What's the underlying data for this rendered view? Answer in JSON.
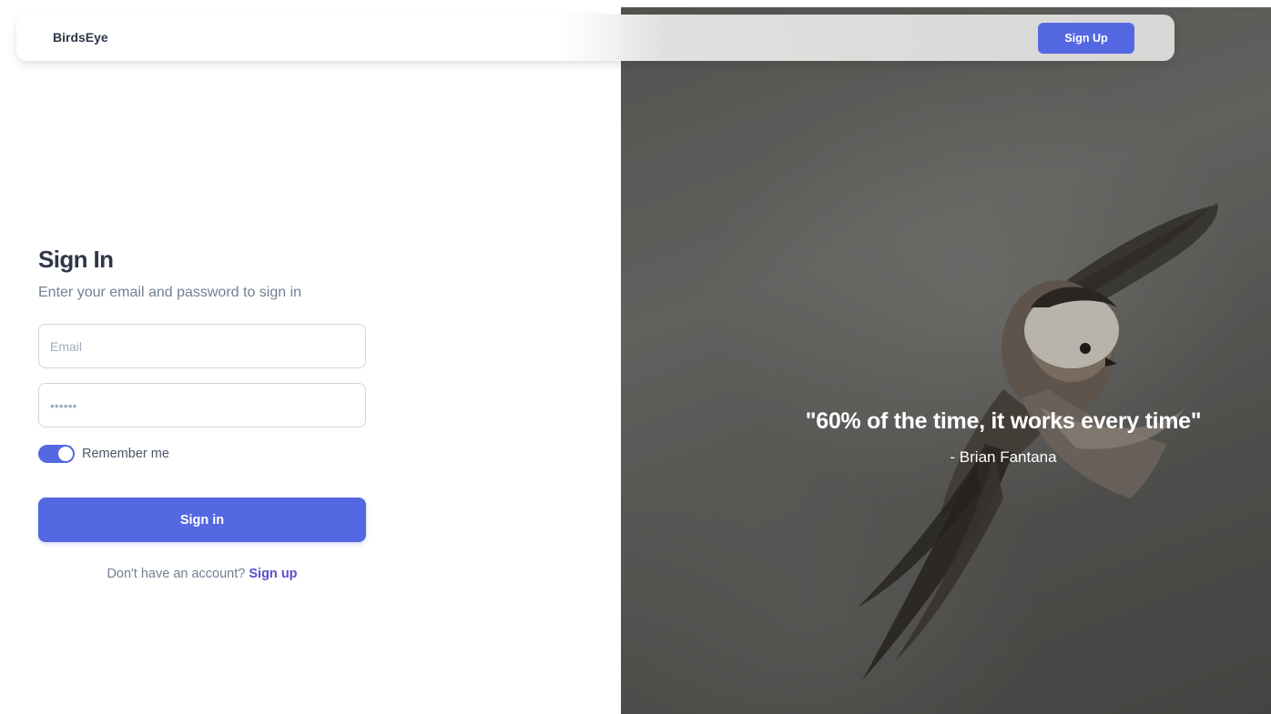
{
  "navbar": {
    "brand": "BirdsEye",
    "signup_button": "Sign Up"
  },
  "form": {
    "title": "Sign In",
    "subtitle": "Enter your email and password to sign in",
    "email_placeholder": "Email",
    "password_placeholder": "••••••",
    "remember_label": "Remember me",
    "remember_on": true,
    "submit_label": "Sign in",
    "footer_text": "Don't have an account? ",
    "footer_link": "Sign up"
  },
  "hero": {
    "quote": "\"60% of the time, it works every time\"",
    "author": "- Brian Fantana"
  },
  "colors": {
    "accent": "#5468e2",
    "link": "#5a4fcf",
    "heading": "#2d3748"
  }
}
